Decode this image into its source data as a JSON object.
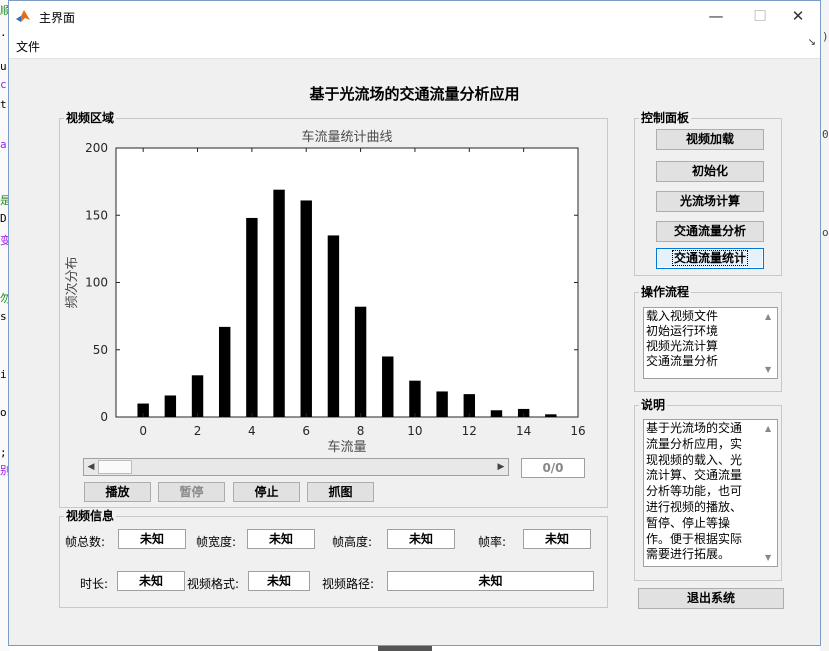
{
  "window": {
    "title": "主界面",
    "minimize": "—",
    "maximize": "☐",
    "close": "✕"
  },
  "menu": {
    "file": "文件",
    "corner_arrow": "↘"
  },
  "main_title": "基于光流场的交通流量分析应用",
  "video_panel": {
    "title": "视频区域",
    "frame_count": "0/0",
    "buttons": {
      "play": "播放",
      "pause": "暂停",
      "stop": "停止",
      "grab": "抓图"
    }
  },
  "chart_data": {
    "type": "bar",
    "title": "车流量统计曲线",
    "xlabel": "车流量",
    "ylabel": "频次分布",
    "x": [
      0,
      1,
      2,
      3,
      4,
      5,
      6,
      7,
      8,
      9,
      10,
      11,
      12,
      13,
      14,
      15
    ],
    "values": [
      10,
      16,
      31,
      67,
      148,
      169,
      161,
      135,
      82,
      45,
      27,
      19,
      17,
      5,
      6,
      2
    ],
    "xlim": [
      -1,
      16
    ],
    "ylim": [
      0,
      200
    ],
    "xticks": [
      0,
      2,
      4,
      6,
      8,
      10,
      12,
      14,
      16
    ],
    "yticks": [
      0,
      50,
      100,
      150,
      200
    ],
    "bar_color": "#000000",
    "grid": false
  },
  "info_panel": {
    "title": "视频信息",
    "total_frames_label": "帧总数:",
    "total_frames": "未知",
    "width_label": "帧宽度:",
    "width": "未知",
    "height_label": "帧高度:",
    "height": "未知",
    "fps_label": "帧率:",
    "fps": "未知",
    "duration_label": "时长:",
    "duration": "未知",
    "format_label": "视频格式:",
    "format": "未知",
    "path_label": "视频路径:",
    "path": "未知"
  },
  "control_panel": {
    "title": "控制面板",
    "buttons": [
      "视频加载",
      "初始化",
      "光流场计算",
      "交通流量分析",
      "交通流量统计"
    ]
  },
  "process_panel": {
    "title": "操作流程",
    "items": [
      "载入视频文件",
      "初始运行环境",
      "视频光流计算",
      "交通流量分析"
    ]
  },
  "desc_panel": {
    "title": "说明",
    "lines": [
      "基于光流场的交通",
      "流量分析应用，实",
      "现视频的载入、光",
      "流计算、交通流量",
      "分析等功能，也可",
      "进行视频的播放、",
      "暂停、停止等操",
      "作。便于根据实际",
      "需要进行拓展。"
    ]
  },
  "exit_button": "退出系统",
  "background": {
    "left_chars": [
      "顺",
      ".",
      "u",
      "c",
      "t",
      "a",
      "是",
      "D",
      "变",
      "勿",
      "s",
      "i",
      "o",
      ";",
      "别"
    ],
    "right_chars": [
      ")",
      "0",
      "o"
    ]
  }
}
